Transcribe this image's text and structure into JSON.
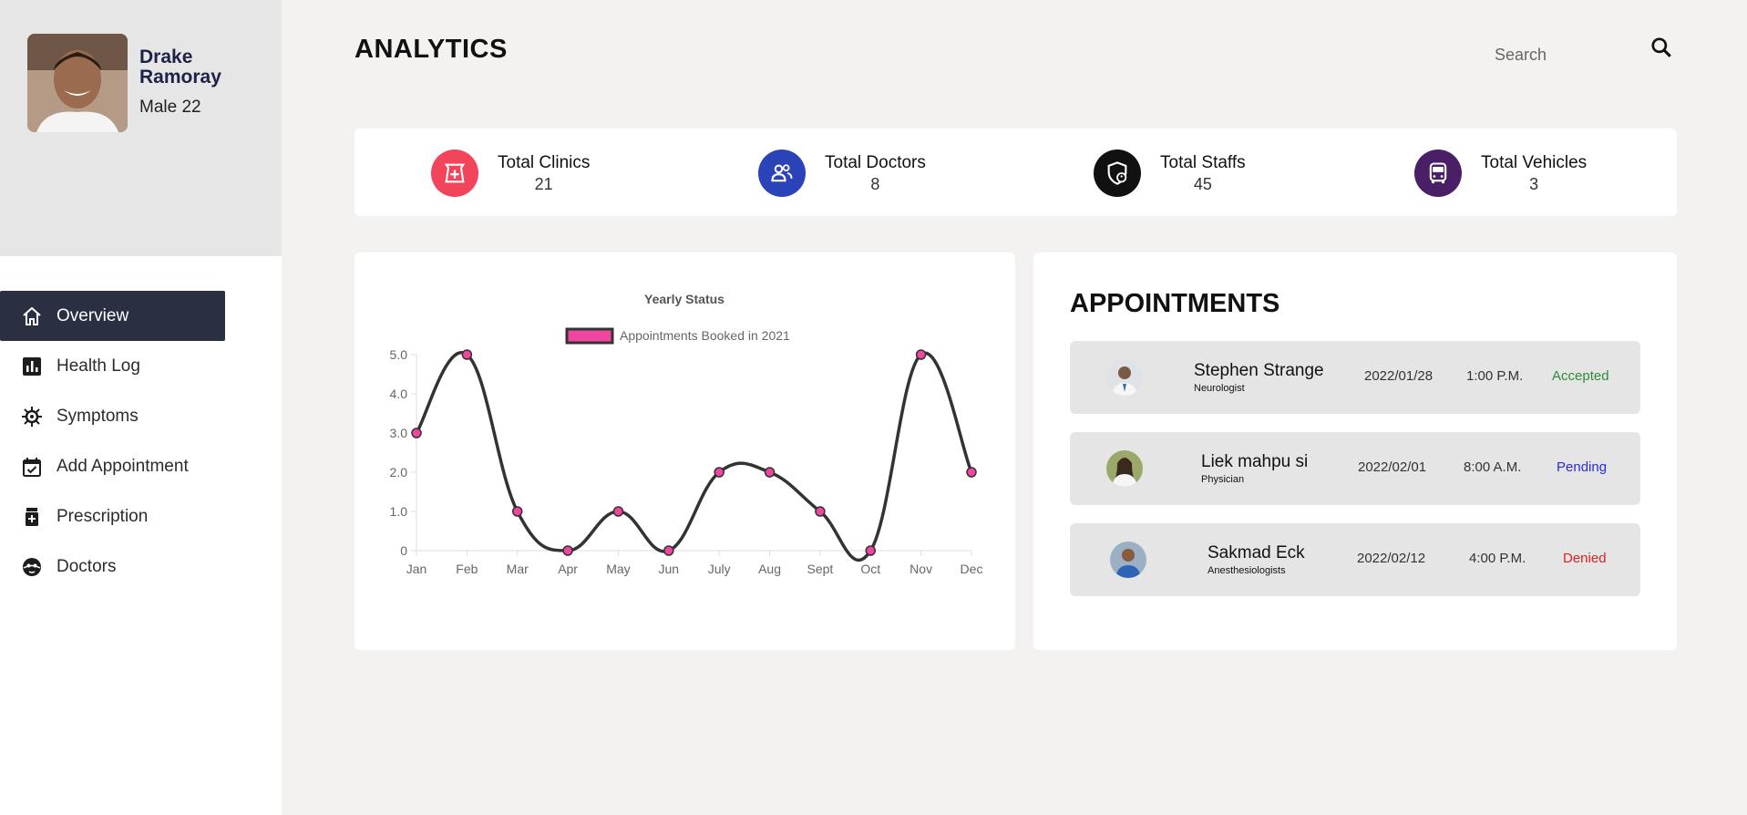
{
  "profile": {
    "name": "Drake Ramoray",
    "meta": "Male 22"
  },
  "nav": {
    "items": [
      {
        "label": "Overview",
        "icon": "home-icon",
        "active": true
      },
      {
        "label": "Health Log",
        "icon": "bar-chart-icon",
        "active": false
      },
      {
        "label": "Symptoms",
        "icon": "virus-icon",
        "active": false
      },
      {
        "label": "Add Appointment",
        "icon": "calendar-check-icon",
        "active": false
      },
      {
        "label": "Prescription",
        "icon": "medicine-bottle-icon",
        "active": false
      },
      {
        "label": "Doctors",
        "icon": "face-icon",
        "active": false
      }
    ]
  },
  "header": {
    "title": "ANALYTICS",
    "search_placeholder": "Search"
  },
  "stats": [
    {
      "label": "Total Clinics",
      "value": "21",
      "icon": "pharmacy-icon",
      "color": "#f2455c"
    },
    {
      "label": "Total Doctors",
      "value": "8",
      "icon": "people-icon",
      "color": "#2b43b8"
    },
    {
      "label": "Total Staffs",
      "value": "45",
      "icon": "shield-user-icon",
      "color": "#111111"
    },
    {
      "label": "Total Vehicles",
      "value": "3",
      "icon": "bus-icon",
      "color": "#4a1f66"
    }
  ],
  "chart_data": {
    "type": "line",
    "title": "Yearly Status",
    "categories": [
      "Jan",
      "Feb",
      "Mar",
      "Apr",
      "May",
      "Jun",
      "July",
      "Aug",
      "Sept",
      "Oct",
      "Nov",
      "Dec"
    ],
    "series": [
      {
        "name": "Appointments Booked in 2021",
        "values": [
          3,
          5,
          1,
          0,
          1,
          0,
          2,
          2,
          1,
          0,
          5,
          2
        ],
        "line_color": "#333333",
        "point_color": "#f046a0"
      }
    ],
    "yticks": [
      "0",
      "1.0",
      "2.0",
      "3.0",
      "4.0",
      "5.0"
    ],
    "ylim": [
      0,
      5
    ],
    "legend_position": "top"
  },
  "appointments": {
    "title": "APPOINTMENTS",
    "items": [
      {
        "name": "Stephen Strange",
        "specialty": "Neurologist",
        "date": "2022/01/28",
        "time": "1:00 P.M.",
        "status": "Accepted",
        "status_color": "#2e8b3a"
      },
      {
        "name": "Liek mahpu si",
        "specialty": "Physician",
        "date": "2022/02/01",
        "time": "8:00 A.M.",
        "status": "Pending",
        "status_color": "#2a2ae0"
      },
      {
        "name": "Sakmad Eck",
        "specialty": "Anesthesiologists",
        "date": "2022/02/12",
        "time": "4:00 P.M.",
        "status": "Denied",
        "status_color": "#e02020"
      }
    ]
  }
}
